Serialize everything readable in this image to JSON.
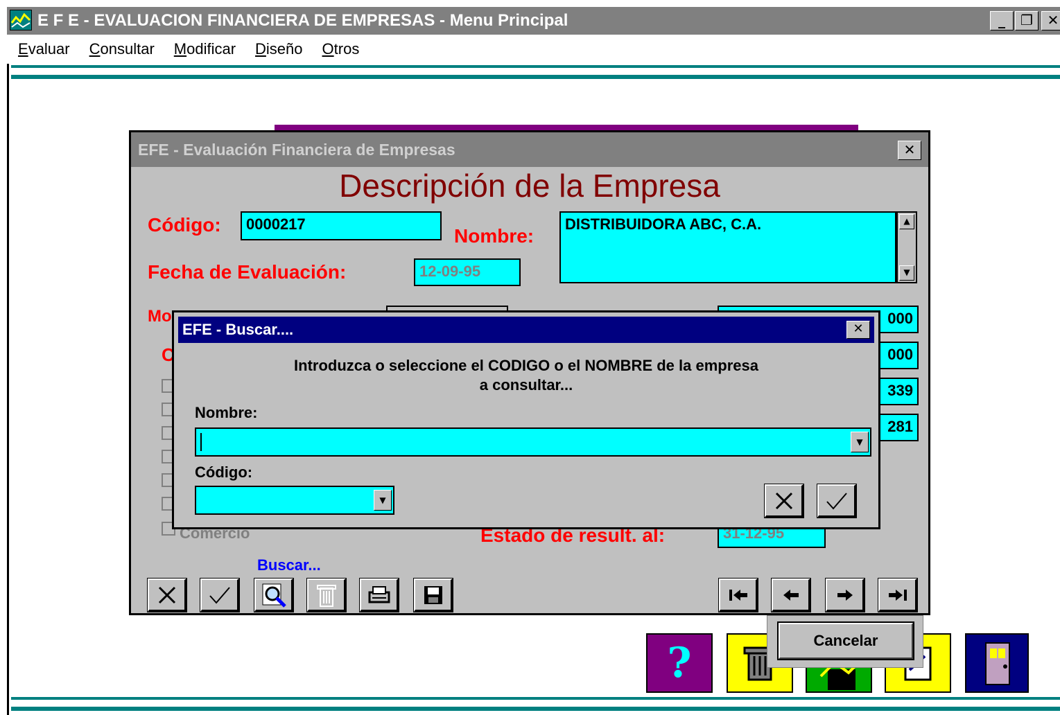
{
  "window": {
    "title": "E F E - EVALUACION FINANCIERA DE EMPRESAS - Menu Principal",
    "controls": {
      "minimize": "_",
      "restore": "❐",
      "close": "✕"
    }
  },
  "menubar": [
    {
      "first": "E",
      "rest": "valuar"
    },
    {
      "first": "C",
      "rest": "onsultar"
    },
    {
      "first": "M",
      "rest": "odificar"
    },
    {
      "first": "D",
      "rest": "iseño"
    },
    {
      "first": "O",
      "rest": "tros"
    }
  ],
  "form": {
    "title": "EFE - Evaluación Financiera de Empresas",
    "heading": "Descripción de la Empresa",
    "codigo_label": "Código:",
    "codigo_value": "0000217",
    "nombre_label": "Nombre:",
    "nombre_value": "DISTRIBUIDORA ABC, C.A.",
    "fecha_label": "Fecha de Evaluación:",
    "fecha_value": "12-09-95",
    "partial_label_mo": "Mo",
    "partial_label_c": "C",
    "right_values": [
      "000",
      "000",
      "339",
      "281"
    ],
    "checkbox_last_label": "Comercio",
    "estado_label": "Estado de result. al:",
    "estado_value": "31-12-95",
    "buscar_hint": "Buscar..."
  },
  "dialog": {
    "title": "EFE - Buscar....",
    "message_line1": "Introduzca o seleccione el CODIGO o el NOMBRE de la empresa",
    "message_line2": "a consultar...",
    "nombre_label": "Nombre:",
    "nombre_value": "",
    "codigo_label": "Código:",
    "codigo_value": ""
  },
  "tooltip": {
    "label": "Cancelar"
  },
  "colors": {
    "titlebar": "#000080",
    "field": "#00ffff",
    "label": "#ff0000",
    "heading": "#800000",
    "teal": "#008080"
  }
}
